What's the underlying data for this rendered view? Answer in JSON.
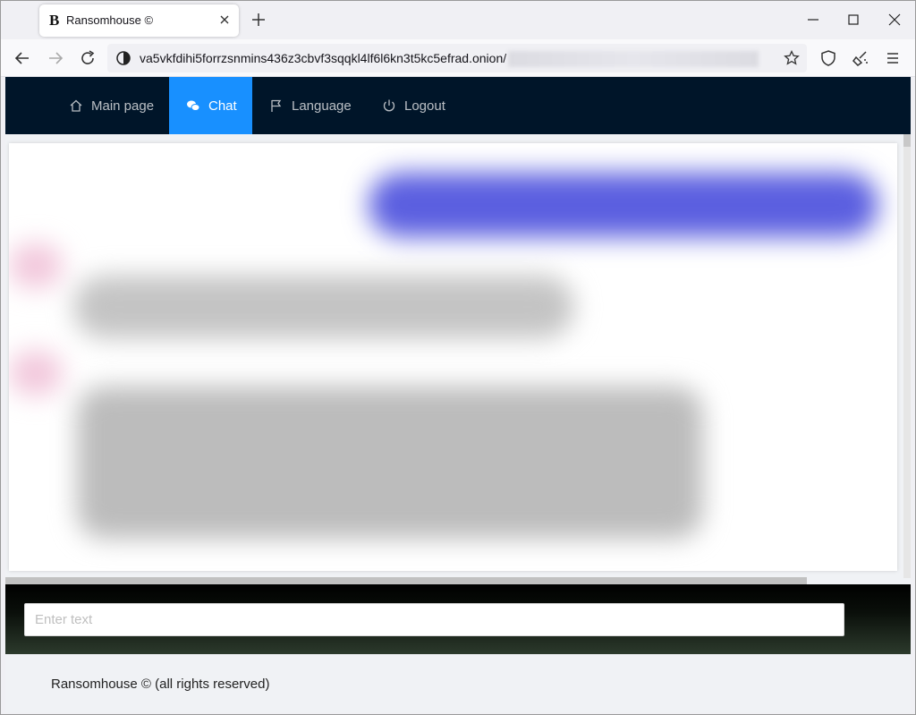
{
  "browser": {
    "tab_title": "Ransomhouse ©",
    "tab_favicon": "B",
    "url": "va5vkfdihi5forrzsnmins436z3cbvf3sqqkl4lf6l6kn3t5kc5efrad.onion/"
  },
  "menu": {
    "items": [
      {
        "label": "Main page",
        "icon": "home-icon"
      },
      {
        "label": "Chat",
        "icon": "wechat-icon"
      },
      {
        "label": "Language",
        "icon": "flag-icon"
      },
      {
        "label": "Logout",
        "icon": "power-icon"
      }
    ],
    "active_index": 1
  },
  "chat": {
    "input_placeholder": "Enter text"
  },
  "footer": {
    "text": "Ransomhouse © (all rights reserved)"
  },
  "colors": {
    "header_bg": "#001529",
    "active_menu": "#1890ff",
    "outgoing_bubble": "#5b5fe0",
    "incoming_bubble": "#c4c4c4"
  }
}
